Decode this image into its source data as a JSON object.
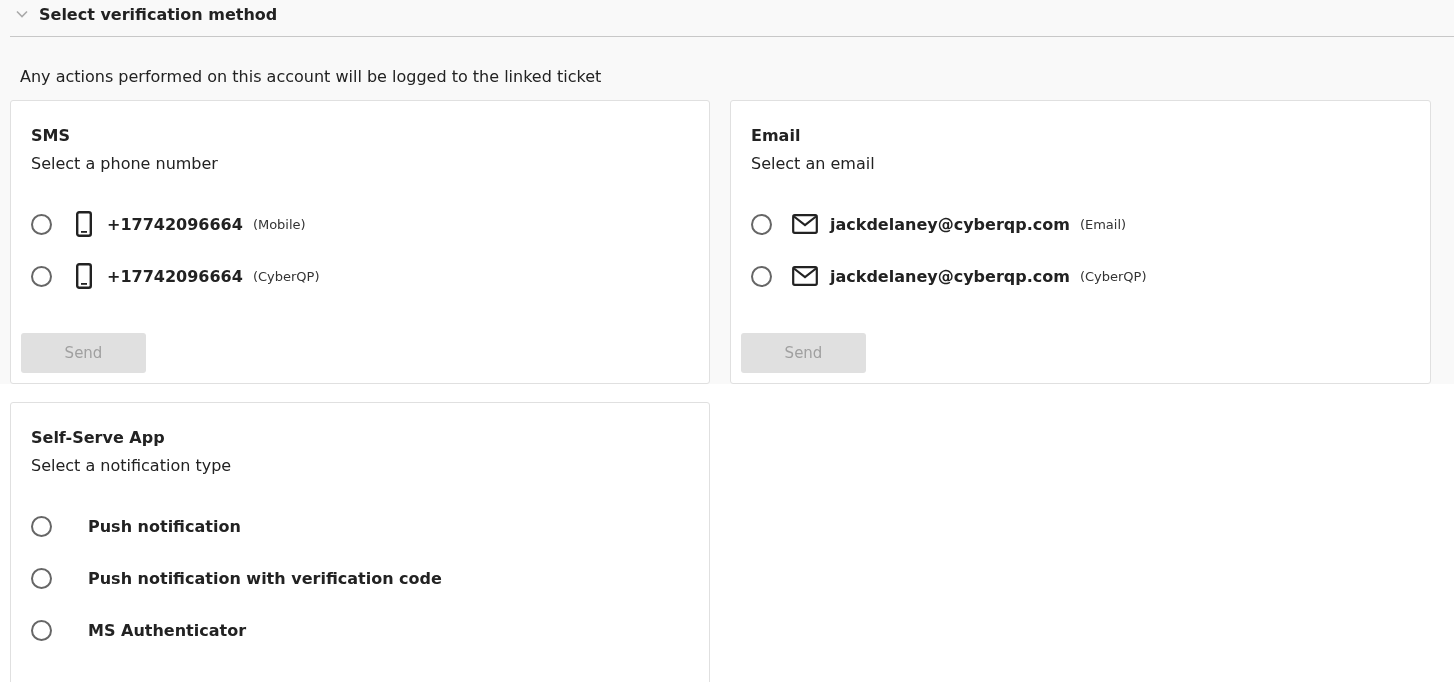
{
  "section": {
    "title": "Select verification method",
    "expanded": true
  },
  "notice": "Any actions performed on this account will be logged to the linked ticket",
  "cards": [
    {
      "title": "SMS",
      "subtitle": "Select a phone number",
      "options": [
        {
          "kind": "phone",
          "label": "+17742096664",
          "tag": "(Mobile)",
          "selected": false
        },
        {
          "kind": "phone",
          "label": "+17742096664",
          "tag": "(CyberQP)",
          "selected": false
        }
      ],
      "button": {
        "label": "Send",
        "disabled": true
      }
    },
    {
      "title": "Email",
      "subtitle": "Select an email",
      "options": [
        {
          "kind": "mail",
          "label": "jackdelaney@cyberqp.com",
          "tag": "(Email)",
          "selected": false
        },
        {
          "kind": "mail",
          "label": "jackdelaney@cyberqp.com",
          "tag": "(CyberQP)",
          "selected": false
        }
      ],
      "button": {
        "label": "Send",
        "disabled": true
      }
    },
    {
      "title": "Self-Serve App",
      "subtitle": "Select a notification type",
      "options": [
        {
          "kind": "plain",
          "label": "Push notification",
          "selected": false
        },
        {
          "kind": "plain",
          "label": "Push notification with verification code",
          "selected": false
        },
        {
          "kind": "plain",
          "label": "MS Authenticator",
          "selected": false
        }
      ]
    }
  ]
}
